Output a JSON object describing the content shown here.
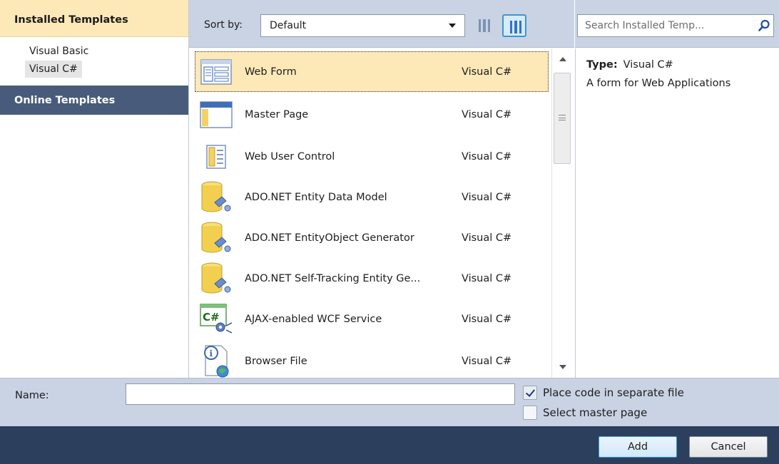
{
  "sidebar": {
    "installed_header": "Installed Templates",
    "tree": [
      "Visual Basic",
      "Visual C#"
    ],
    "online_header": "Online Templates"
  },
  "toolbar": {
    "sort_label": "Sort by:",
    "sort_value": "Default"
  },
  "search": {
    "placeholder": "Search Installed Temp..."
  },
  "templates": [
    {
      "name": "Web Form",
      "lang": "Visual C#",
      "icon": "web-form-icon"
    },
    {
      "name": "Master Page",
      "lang": "Visual C#",
      "icon": "master-page-icon"
    },
    {
      "name": "Web User Control",
      "lang": "Visual C#",
      "icon": "web-user-control-icon"
    },
    {
      "name": "ADO.NET Entity Data Model",
      "lang": "Visual C#",
      "icon": "database-icon"
    },
    {
      "name": "ADO.NET EntityObject Generator",
      "lang": "Visual C#",
      "icon": "database-icon"
    },
    {
      "name": "ADO.NET Self-Tracking Entity Ge...",
      "lang": "Visual C#",
      "icon": "database-icon"
    },
    {
      "name": "AJAX-enabled WCF Service",
      "lang": "Visual C#",
      "icon": "csharp-service-icon"
    },
    {
      "name": "Browser File",
      "lang": "Visual C#",
      "icon": "browser-file-icon"
    }
  ],
  "details": {
    "type_label": "Type:",
    "type_value": "Visual C#",
    "description": "A form for Web Applications"
  },
  "namebar": {
    "name_label": "Name:",
    "name_value": "",
    "place_code_label": "Place code in separate file",
    "place_code_checked": true,
    "select_master_label": "Select master page",
    "select_master_checked": false
  },
  "footer": {
    "add_label": "Add",
    "cancel_label": "Cancel"
  },
  "colors": {
    "selected_row": "#fde8b8",
    "panel_bg": "#c9d3e3",
    "header_dark": "#485b7a",
    "footer_dark": "#2c3f5d"
  }
}
